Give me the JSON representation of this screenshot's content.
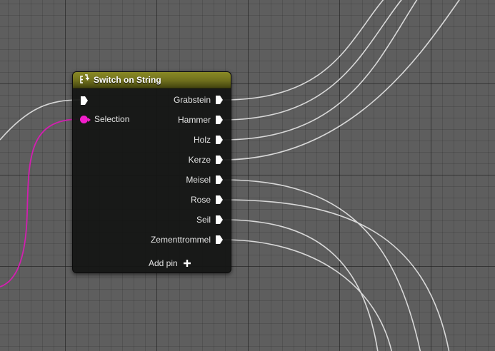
{
  "node": {
    "title": "Switch on String",
    "icon": "switch-icon",
    "header_color": "#7d7e22",
    "input_exec_icon": "exec-pin-icon",
    "selection": {
      "label": "Selection",
      "pin_color": "#f21ecb",
      "type": "string"
    },
    "outputs": [
      {
        "label": "Grabstein"
      },
      {
        "label": "Hammer"
      },
      {
        "label": "Holz"
      },
      {
        "label": "Kerze"
      },
      {
        "label": "Meisel"
      },
      {
        "label": "Rose"
      },
      {
        "label": "Seil"
      },
      {
        "label": "Zementtrommel"
      }
    ],
    "add_pin_label": "Add pin",
    "add_pin_icon": "plus-icon"
  },
  "graph": {
    "exec_wire_color": "#d8d8d8",
    "string_wire_color": "#d21fb0"
  }
}
